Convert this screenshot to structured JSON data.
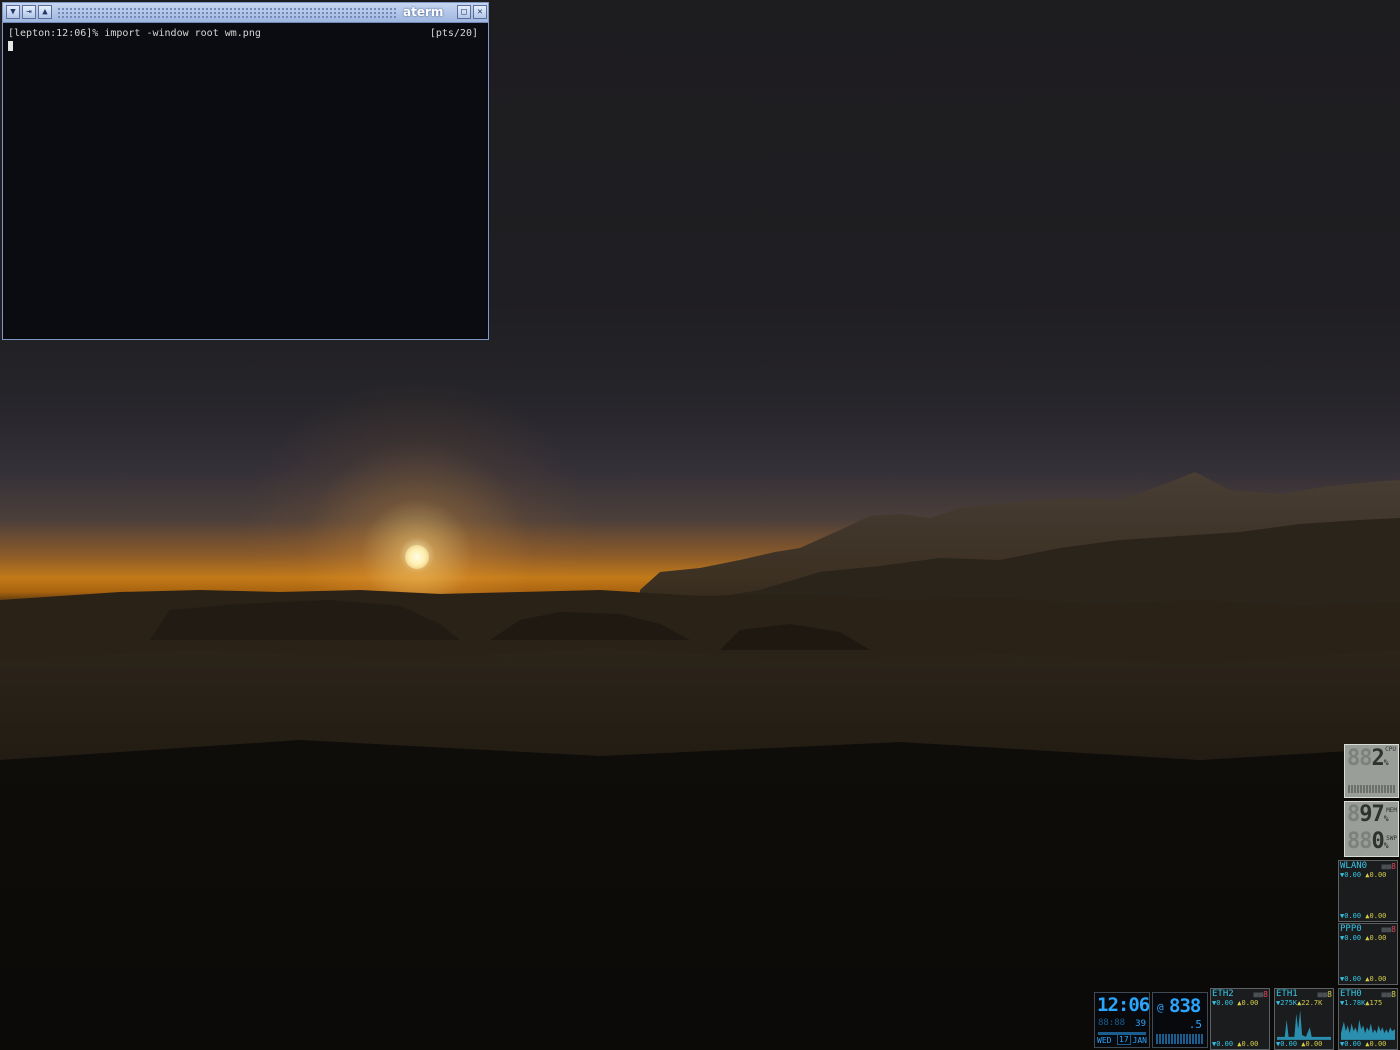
{
  "window": {
    "title": "aterm",
    "prompt": "[lepton:12:06]% import -window root wm.png",
    "pts": "[pts/20]"
  },
  "dock": {
    "cpu": {
      "value": "2",
      "ghost": "88",
      "unit": "%",
      "label": "CPU"
    },
    "mem": {
      "value": "97",
      "ghost": "8",
      "unit": "%",
      "label": "MEM"
    },
    "swap": {
      "value": "0",
      "ghost": "88",
      "unit": "%",
      "label": "SWP"
    },
    "wlan0": {
      "name": "WLAN0",
      "leds": "8",
      "rx": "▼0.00",
      "tx": "▲0.00",
      "total_rx": "▼0.00",
      "total_tx": "▲0.00"
    },
    "ppp0": {
      "name": "PPP0",
      "leds": "8",
      "rx": "▼0.00",
      "tx": "▲0.00",
      "total_rx": "▼0.00",
      "total_tx": "▲0.00"
    },
    "eth2": {
      "name": "ETH2",
      "leds": "8",
      "rx": "▼0.00",
      "tx": "▲0.00",
      "total_rx": "▼0.00",
      "total_tx": "▲0.00"
    },
    "eth1": {
      "name": "ETH1",
      "leds": "8",
      "rx": "▼275K",
      "tx": "▲22.7K",
      "total_rx": "▼0.00",
      "total_tx": "▲0.00"
    },
    "eth0": {
      "name": "ETH0",
      "leds": "8",
      "rx": "▼1.78K",
      "tx": "▲175",
      "total_rx": "▼0.00",
      "total_tx": "▲0.00"
    },
    "clock": {
      "time": "12:06",
      "seconds": "39",
      "weekday": "WED",
      "day": "17",
      "month": "JAN"
    },
    "beat": {
      "prefix": "@",
      "value": "838",
      "fraction": ".5"
    }
  },
  "colors": {
    "title_bar": "#9fb6df",
    "terminal_bg": "#0b0c11",
    "dock_cyan": "#37c6e6",
    "dock_blue": "#2ba6ff"
  }
}
